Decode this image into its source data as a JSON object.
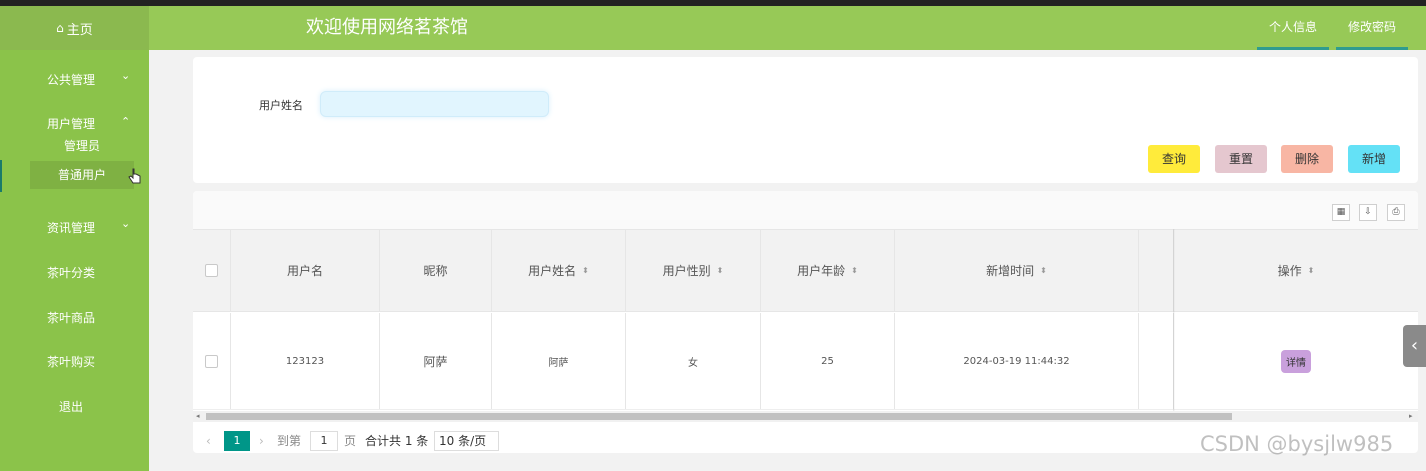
{
  "header": {
    "home_label": "主页",
    "title": "欢迎使用网络茗茶馆",
    "profile_label": "个人信息",
    "password_label": "修改密码"
  },
  "sidebar": {
    "items": [
      {
        "label": "公共管理",
        "chevron": "⌄"
      },
      {
        "label": "用户管理",
        "chevron": "⌃"
      },
      {
        "label": "资讯管理",
        "chevron": "⌄"
      },
      {
        "label": "茶叶分类"
      },
      {
        "label": "茶叶商品"
      },
      {
        "label": "茶叶购买"
      },
      {
        "label": "退出"
      }
    ],
    "sub_items": [
      {
        "label": "管理员"
      },
      {
        "label": "普通用户",
        "active": true
      }
    ]
  },
  "search": {
    "label": "用户姓名",
    "value": "",
    "placeholder": ""
  },
  "buttons": {
    "query": "查询",
    "reset": "重置",
    "delete": "删除",
    "add": "新增"
  },
  "table": {
    "columns": [
      "用户名",
      "昵称",
      "用户姓名",
      "用户性别",
      "用户年龄",
      "新增时间",
      "",
      "操作"
    ],
    "sortable": [
      false,
      false,
      true,
      true,
      true,
      true,
      false,
      true
    ],
    "rows": [
      {
        "username": "123123",
        "nickname": "阿萨",
        "realname": "阿萨",
        "gender": "女",
        "age": "25",
        "created": "2024-03-19 11:44:32",
        "action": "详情"
      }
    ]
  },
  "pagination": {
    "current_page": "1",
    "goto_label": "到第",
    "goto_value": "1",
    "page_unit": "页",
    "total_text": "合计共 1 条",
    "page_size": "10 条/页"
  },
  "watermark": "CSDN @bysjlw985",
  "colors": {
    "header_bg": "#97c957",
    "sidebar_bg": "#8bc34a",
    "query_btn": "#ffeb3b",
    "reset_btn": "#e5c7cf",
    "delete_btn": "#f8b6a4",
    "add_btn": "#64e1f6",
    "pager_active": "#009688",
    "detail_btn": "#c9a0dc"
  }
}
